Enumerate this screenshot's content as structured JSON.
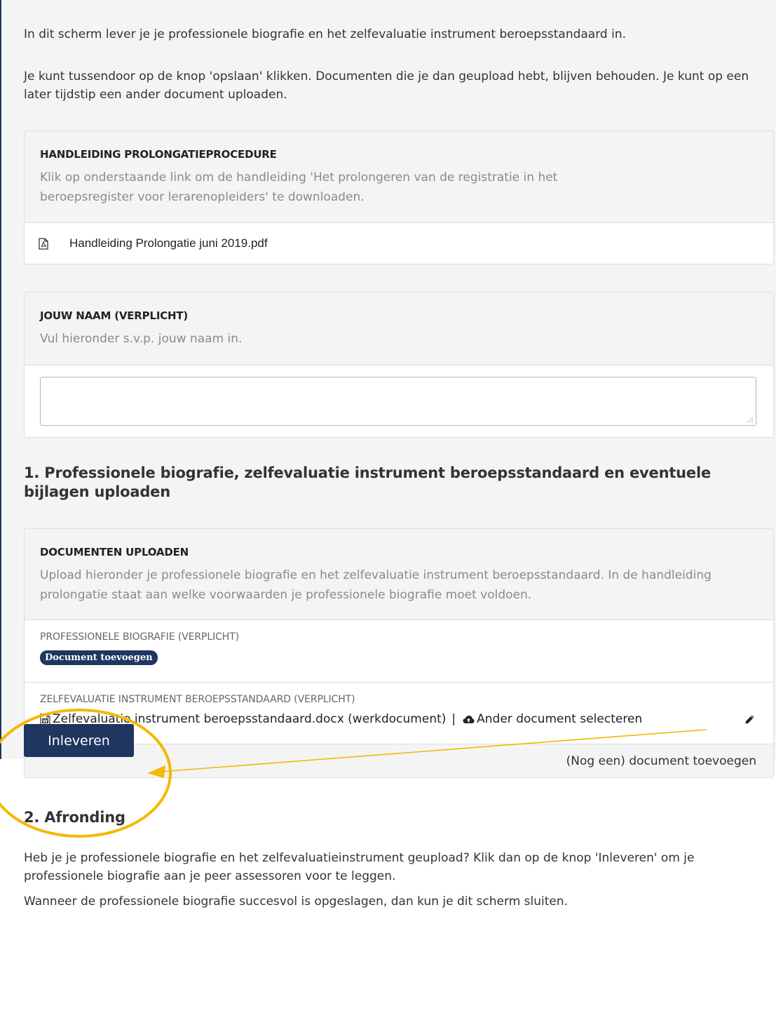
{
  "intro": {
    "line1": "In dit scherm lever je je professionele biografie en het zelfevaluatie instrument beroepsstandaard in.",
    "line2": "Je kunt tussendoor op de knop 'opslaan' klikken. Documenten die je dan geupload hebt, blijven behouden. Je kunt op een later tijdstip een ander document uploaden."
  },
  "manual_card": {
    "title": "HANDLEIDING PROLONGATIEPROCEDURE",
    "description": "Klik op onderstaande link om de handleiding 'Het prolongeren van de registratie in het beroepsregister voor lerarenopleiders' te downloaden.",
    "file_name": "Handleiding Prolongatie juni 2019.pdf"
  },
  "name_card": {
    "title": "JOUW NAAM (VERPLICHT)",
    "description": "Vul hieronder s.v.p. jouw naam in.",
    "value": ""
  },
  "section1": {
    "heading": "1. Professionele biografie, zelfevaluatie instrument beroepsstandaard en eventuele bijlagen uploaden"
  },
  "upload_card": {
    "title": "DOCUMENTEN UPLOADEN",
    "description": "Upload hieronder je professionele biografie en het zelfevaluatie instrument beroepsstandaard. In de handleiding prolongatie staat aan welke voorwaarden je professionele biografie moet voldoen.",
    "field1_label": "PROFESSIONELE BIOGRAFIE (VERPLICHT)",
    "field1_button": "Document toevoegen",
    "field2_label": "ZELFEVALUATIE INSTRUMENT BEROEPSSTANDAARD (VERPLICHT)",
    "field2_file": "Zelfevaluatie instrument beroepsstandaard.docx (werkdocument)",
    "field2_separator": "|",
    "field2_action": "Ander document selecteren",
    "add_more": "(Nog een) document toevoegen"
  },
  "section2": {
    "heading": "2. Afronding",
    "text1": "Heb je je professionele biografie en het zelfevaluatieinstrument geupload? Klik dan op de knop 'Inleveren' om je professionele biografie aan je peer assessoren voor te leggen.",
    "text2": "Wanneer de professionele biografie succesvol is opgeslagen, dan kun je dit scherm sluiten."
  },
  "submit_label": "Inleveren",
  "colors": {
    "accent": "#1f3660",
    "annotation": "#f5b800"
  }
}
